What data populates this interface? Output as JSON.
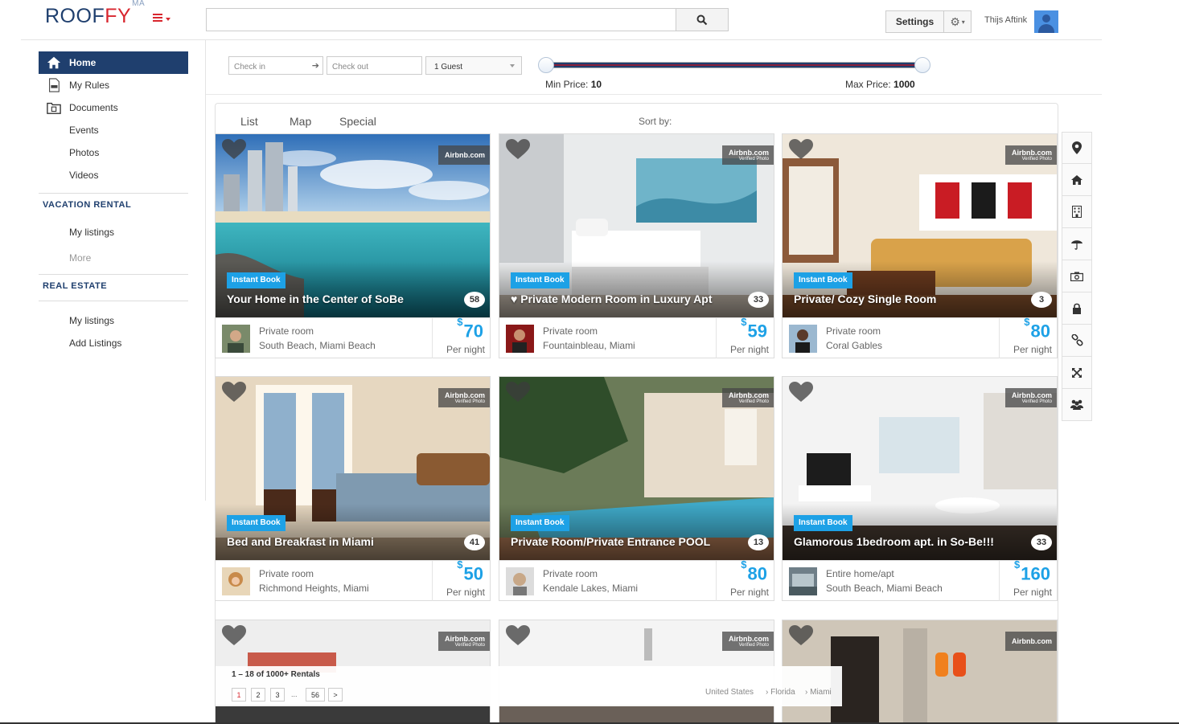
{
  "header": {
    "logo_main": "ROOF",
    "logo_accent": "FY",
    "logo_sup": "MA",
    "search_placeholder": "",
    "settings_label": "Settings",
    "user_name": "Thijs Aftink"
  },
  "sidebar": {
    "main_items": [
      {
        "label": "Home",
        "icon": "home-icon"
      },
      {
        "label": "My Rules",
        "icon": "document-icon"
      },
      {
        "label": "Documents",
        "icon": "folder-icon"
      },
      {
        "label": "Events"
      },
      {
        "label": "Photos"
      },
      {
        "label": "Videos"
      }
    ],
    "vacation_heading": "VACATION RENTAL",
    "vacation_items": [
      {
        "label": "My listings"
      },
      {
        "label": "More"
      }
    ],
    "realestate_heading": "REAL ESTATE",
    "realestate_items": [
      {
        "label": "My listings"
      },
      {
        "label": "Add Listings"
      }
    ]
  },
  "filters": {
    "checkin_placeholder": "Check in",
    "checkout_placeholder": "Check out",
    "guests": "1 Guest",
    "min_price_label": "Min Price:",
    "min_price": "10",
    "max_price_label": "Max Price:",
    "max_price": "1000"
  },
  "tabs": {
    "list": "List",
    "map": "Map",
    "special": "Special",
    "sort_by": "Sort by:"
  },
  "rail_icons": [
    "map-marker-icon",
    "home-icon",
    "building-icon",
    "umbrella-icon",
    "camera-icon",
    "lock-icon",
    "link-icon",
    "expand-icon",
    "users-icon"
  ],
  "badges": {
    "instant_book": "Instant Book",
    "airbnb": "Airbnb.com",
    "verified": "Verified Photo",
    "per_night": "Per night",
    "currency": "$"
  },
  "listings": [
    {
      "title": "Your Home in the Center of SoBe",
      "reviews": "58",
      "type": "Private room",
      "location": "South Beach, Miami Beach",
      "price": "70",
      "instant": true,
      "verified": false
    },
    {
      "title": "♥ Private Modern Room in Luxury Apt",
      "reviews": "33",
      "type": "Private room",
      "location": "Fountainbleau, Miami",
      "price": "59",
      "instant": true,
      "verified": true
    },
    {
      "title": "Private/ Cozy Single Room",
      "reviews": "3",
      "type": "Private room",
      "location": "Coral Gables",
      "price": "80",
      "instant": true,
      "verified": true
    },
    {
      "title": "Bed and Breakfast in Miami",
      "reviews": "41",
      "type": "Private room",
      "location": "Richmond Heights, Miami",
      "price": "50",
      "instant": true,
      "verified": true
    },
    {
      "title": "Private Room/Private Entrance POOL",
      "reviews": "13",
      "type": "Private room",
      "location": "Kendale Lakes, Miami",
      "price": "80",
      "instant": true,
      "verified": true
    },
    {
      "title": "Glamorous 1bedroom apt. in So-Be!!!",
      "reviews": "33",
      "type": "Entire home/apt",
      "location": "South Beach, Miami Beach",
      "price": "160",
      "instant": true,
      "verified": true
    }
  ],
  "pager": {
    "count": "1 – 18 of 1000+ Rentals",
    "pages": [
      "1",
      "2",
      "3",
      "...",
      "56",
      ">"
    ],
    "breadcrumb": [
      "United States",
      "Florida",
      "Miami"
    ]
  },
  "colors": {
    "brand_navy": "#1f3f6e",
    "brand_red": "#d8262e",
    "accent_blue": "#1da1e6"
  }
}
